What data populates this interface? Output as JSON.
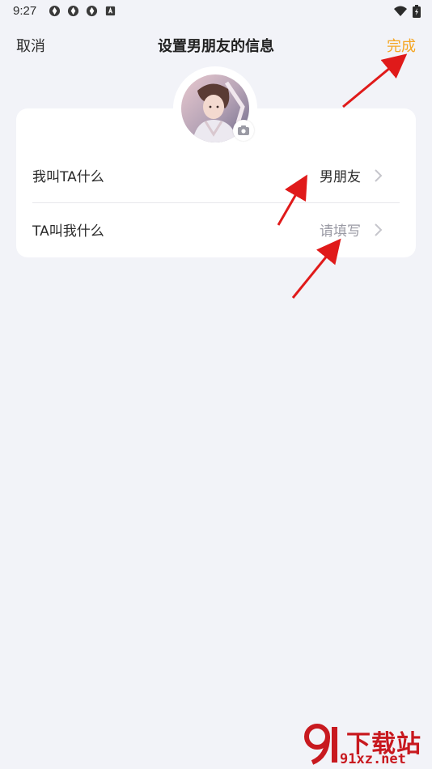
{
  "status_bar": {
    "time": "9:27"
  },
  "header": {
    "cancel_label": "取消",
    "title": "设置男朋友的信息",
    "done_label": "完成"
  },
  "rows": [
    {
      "label": "我叫TA什么",
      "value": "男朋友",
      "is_placeholder": false
    },
    {
      "label": "TA叫我什么",
      "value": "请填写",
      "is_placeholder": true
    }
  ],
  "colors": {
    "accent": "#f5a623",
    "background": "#f2f3f8",
    "arrow": "#e01a1a",
    "watermark": "#c8191f"
  },
  "icons": [
    "aperture-icon",
    "keyboard-icon",
    "wifi-icon",
    "battery-icon",
    "camera-icon",
    "chevron-right-icon"
  ],
  "watermark": {
    "brand_top": "下载站",
    "brand_bottom": "91xz.net"
  }
}
